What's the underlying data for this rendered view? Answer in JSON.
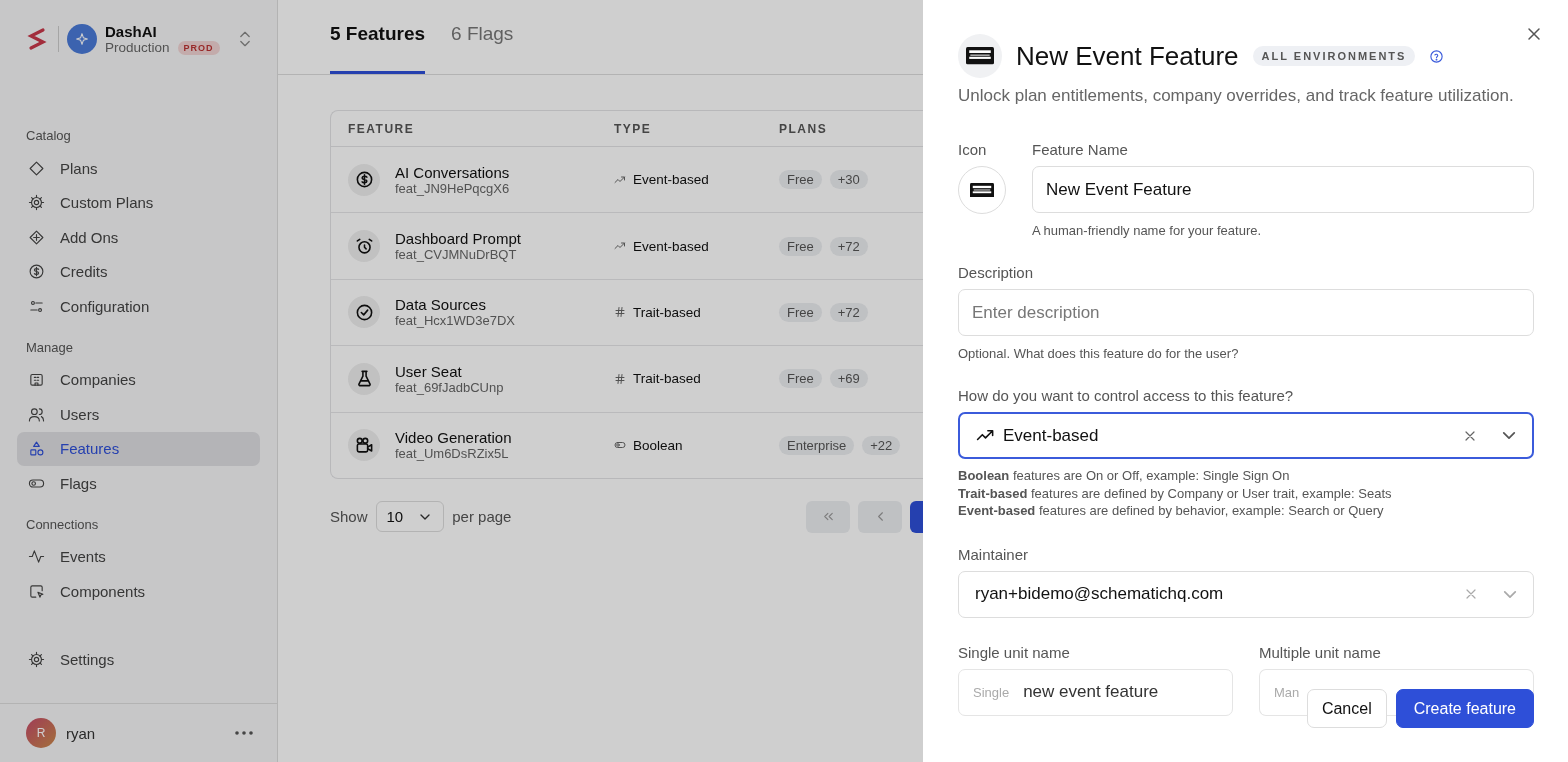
{
  "sidebar": {
    "org": "DashAI",
    "environment": "Production",
    "env_badge": "PROD",
    "sections": [
      {
        "title": "Catalog",
        "items": [
          {
            "label": "Plans",
            "selected": false
          },
          {
            "label": "Custom Plans",
            "selected": false
          },
          {
            "label": "Add Ons",
            "selected": false
          },
          {
            "label": "Credits",
            "selected": false
          },
          {
            "label": "Configuration",
            "selected": false
          }
        ]
      },
      {
        "title": "Manage",
        "items": [
          {
            "label": "Companies",
            "selected": false
          },
          {
            "label": "Users",
            "selected": false
          },
          {
            "label": "Features",
            "selected": true
          },
          {
            "label": "Flags",
            "selected": false
          }
        ]
      },
      {
        "title": "Connections",
        "items": [
          {
            "label": "Events",
            "selected": false
          },
          {
            "label": "Components",
            "selected": false
          }
        ]
      }
    ],
    "settings": {
      "label": "Settings",
      "selected": false
    },
    "user": {
      "initial": "R",
      "name": "ryan"
    }
  },
  "tabs": [
    {
      "label": "5 Features",
      "selected": true
    },
    {
      "label": "6 Flags",
      "selected": false
    }
  ],
  "table": {
    "columns": [
      "FEATURE",
      "TYPE",
      "PLANS"
    ],
    "rows": [
      {
        "name": "AI Conversations",
        "id": "feat_JN9HePqcgX6",
        "kind": "event",
        "type": "Event-based",
        "plans": [
          "Free",
          "+30"
        ]
      },
      {
        "name": "Dashboard Prompt",
        "id": "feat_CVJMNuDrBQT",
        "kind": "event",
        "type": "Event-based",
        "plans": [
          "Free",
          "+72"
        ]
      },
      {
        "name": "Data Sources",
        "id": "feat_Hcx1WD3e7DX",
        "kind": "trait",
        "type": "Trait-based",
        "plans": [
          "Free",
          "+72"
        ]
      },
      {
        "name": "User Seat",
        "id": "feat_69fJadbCUnp",
        "kind": "trait",
        "type": "Trait-based",
        "plans": [
          "Free",
          "+69"
        ]
      },
      {
        "name": "Video Generation",
        "id": "feat_Um6DsRZix5L",
        "kind": "boolean",
        "type": "Boolean",
        "plans": [
          "Enterprise",
          "+22"
        ]
      }
    ]
  },
  "pagination": {
    "show": "Show",
    "page_size": "10",
    "per_page": "per page"
  },
  "drawer": {
    "title": "New Event Feature",
    "badge": "ALL ENVIRONMENTS",
    "subtitle": "Unlock plan entitlements, company overrides, and track feature utilization.",
    "icon_label": "Icon",
    "name_label": "Feature Name",
    "name_value": "New Event Feature",
    "name_hint": "A human-friendly name for your feature.",
    "description_label": "Description",
    "description_placeholder": "Enter description",
    "description_hint": "Optional. What does this feature do for the user?",
    "access": {
      "label": "How do you want to control access to this feature?",
      "kind": "event",
      "value": "Event-based",
      "help": [
        "**Boolean** features are On or Off, example: Single Sign On",
        "**Trait-based** features are defined by Company or User trait, example: Seats",
        "**Event-based** features are defined by behavior, example: Search or Query"
      ]
    },
    "maintainer_label": "Maintainer",
    "maintainer_value": "ryan+bidemo@schematichq.com",
    "single_label": "Single unit name",
    "single_prefix": "Single",
    "single_value": "new event feature",
    "multiple_label": "Multiple unit name",
    "multiple_prefix": "Man",
    "buttons": [
      {
        "label": "Cancel",
        "kind": "secondary"
      },
      {
        "label": "Create feature",
        "kind": "primary"
      }
    ]
  }
}
